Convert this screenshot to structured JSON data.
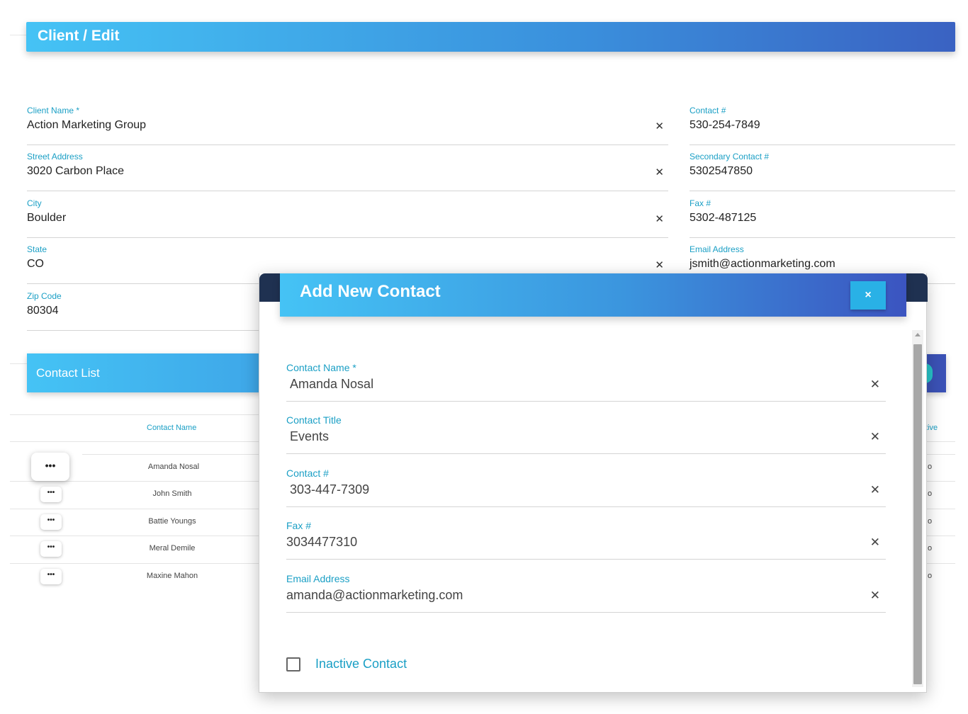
{
  "page": {
    "title": "Client / Edit"
  },
  "client_form": {
    "client_name": {
      "label": "Client Name *",
      "value": "Action Marketing Group"
    },
    "street_address": {
      "label": "Street Address",
      "value": "3020 Carbon Place"
    },
    "city": {
      "label": "City",
      "value": "Boulder"
    },
    "state": {
      "label": "State",
      "value": "CO"
    },
    "zip_code": {
      "label": "Zip Code",
      "value": "80304"
    },
    "contact_number": {
      "label": "Contact #",
      "value": "530-254-7849"
    },
    "secondary_contact": {
      "label": "Secondary Contact #",
      "value": "5302547850"
    },
    "fax": {
      "label": "Fax #",
      "value": "5302-487125"
    },
    "email": {
      "label": "Email Address",
      "value": "jsmith@actionmarketing.com"
    },
    "clear_glyph": "✕"
  },
  "contact_list": {
    "title": "Contact List",
    "column_header": "Contact Name",
    "column_header_right": "tive",
    "row_button_label": "•••",
    "rows": [
      {
        "name": "Amanda Nosal",
        "right": "o"
      },
      {
        "name": "John Smith",
        "right": "o"
      },
      {
        "name": "Battie Youngs",
        "right": "o"
      },
      {
        "name": "Meral Demile",
        "right": "o"
      },
      {
        "name": "Maxine Mahon",
        "right": "o"
      }
    ]
  },
  "modal": {
    "title": "Add New Contact",
    "close_label": "×",
    "fields": [
      {
        "label": "Contact Name *",
        "value": "Amanda Nosal"
      },
      {
        "label": "Contact Title",
        "value": "Events"
      },
      {
        "label": "Contact #",
        "value": "303-447-7309"
      },
      {
        "label": "Fax #",
        "value": "3034477310"
      },
      {
        "label": "Email Address",
        "value": "amanda@actionmarketing.com"
      }
    ],
    "inactive_label": "Inactive Contact",
    "inactive_checked": false
  },
  "colors": {
    "accent": "#1a9fc5",
    "header_start": "#45c3f5",
    "header_end": "#3a62c2",
    "modal_band": "#1f3151",
    "close_button": "#29b1e6",
    "fab": "#27c4c9"
  },
  "icons": {
    "clear": "close-icon",
    "more": "more-horizontal-icon",
    "scroll_up": "triangle-up-icon"
  }
}
